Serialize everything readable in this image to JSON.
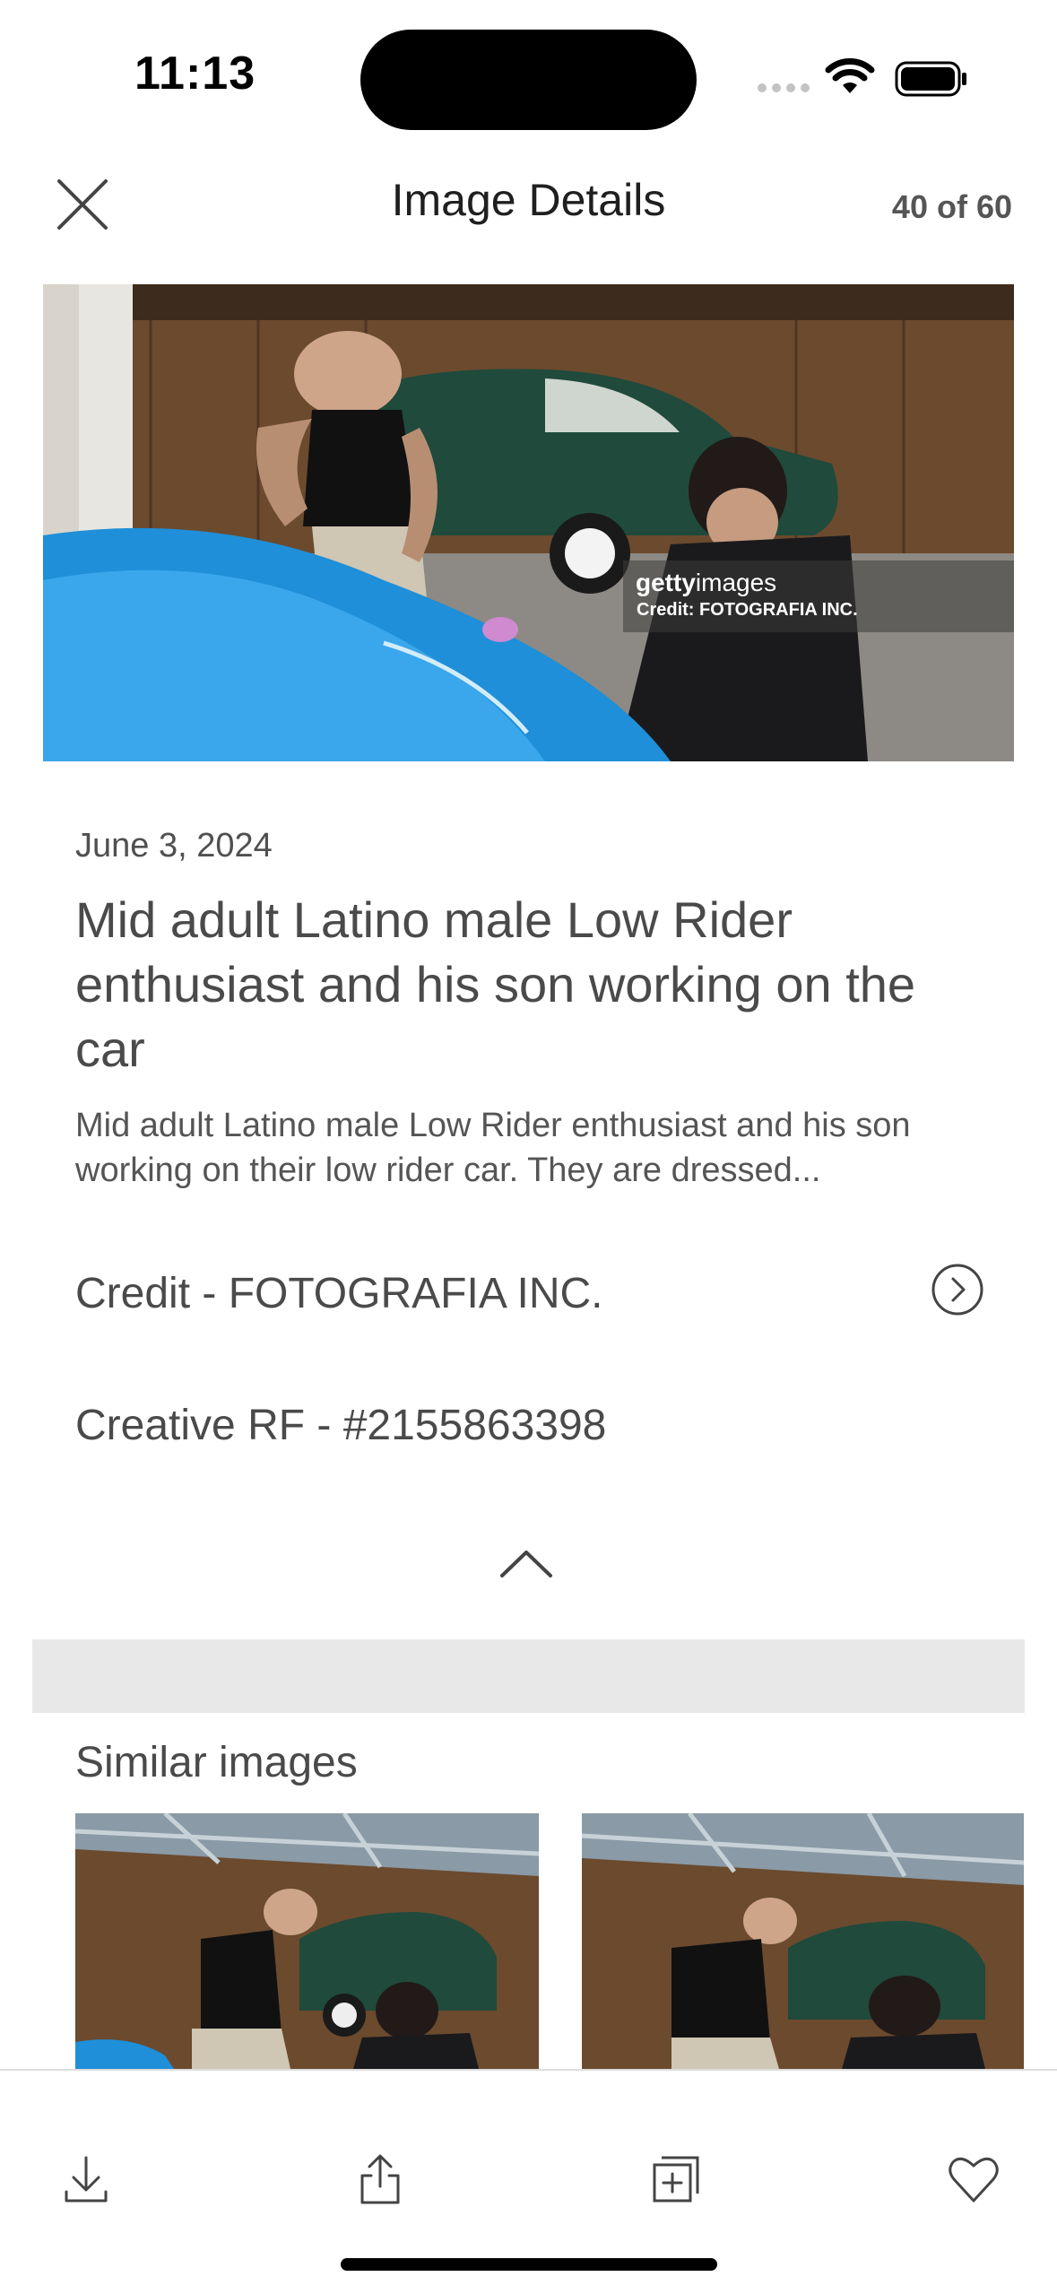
{
  "status_bar": {
    "time": "11:13"
  },
  "header": {
    "title": "Image Details",
    "counter": "40 of 60"
  },
  "photo": {
    "watermark_brand_bold": "getty",
    "watermark_brand_light": "images",
    "watermark_credit": "Credit: FOTOGRAFIA INC."
  },
  "details": {
    "date": "June 3, 2024",
    "headline": "Mid adult Latino male Low Rider enthusiast and his son working on the car",
    "caption": "Mid adult Latino male Low Rider enthusiast and his son working on their low rider car. They are  dressed...",
    "credit": "Credit - FOTOGRAFIA INC.",
    "license": "Creative RF - #2155863398"
  },
  "similar": {
    "title": "Similar images"
  },
  "icons": {
    "close": "close-icon",
    "credit_arrow": "chevron-right-circle-icon",
    "collapse": "chevron-up-icon",
    "download": "download-icon",
    "share": "share-icon",
    "add_to_board": "add-to-board-icon",
    "favorite": "heart-icon"
  },
  "colors": {
    "text": "#4a4a4a",
    "band": "#e8e8e8",
    "car_blue": "#1e8fd8",
    "car_green": "#1f4a3c"
  }
}
